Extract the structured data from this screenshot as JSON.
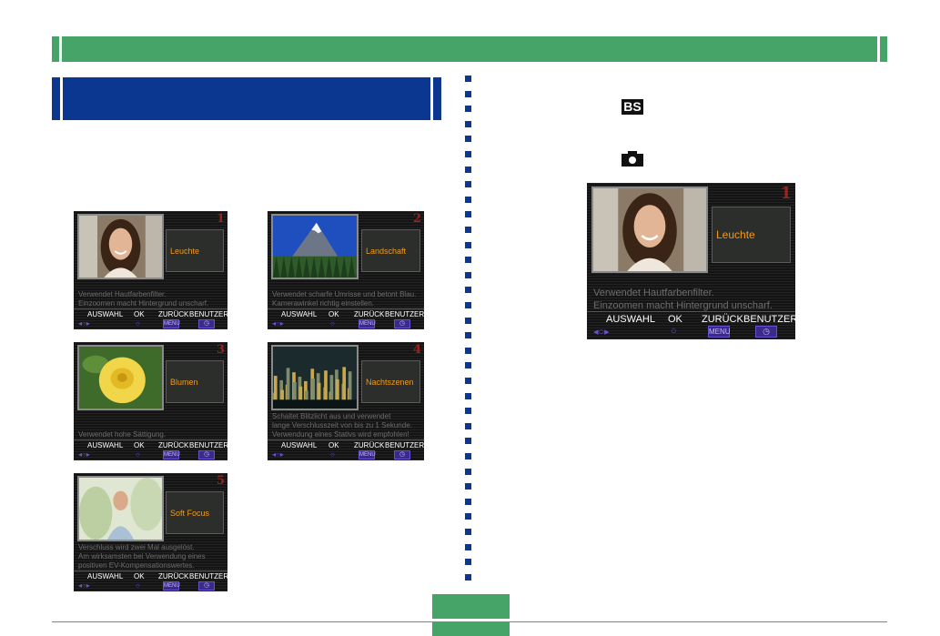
{
  "screens": [
    {
      "number": "1",
      "name": "Leuchte",
      "desc": "Verwendet Hautfarbenfilter.\nEinzoomen macht Hintergrund unscharf."
    },
    {
      "number": "2",
      "name": "Landschaft",
      "desc": "Verwendet scharfe Umrisse und betont Blau.\nKamerawinkel richtig einstellen."
    },
    {
      "number": "3",
      "name": "Blumen",
      "desc": "Verwendet hohe Sättigung."
    },
    {
      "number": "4",
      "name": "Nachtszenen",
      "desc": "Schaltet Blitzlicht aus und verwendet\nlange Verschlusszeit von bis zu 1 Sekunde.\nVerwendung eines Stativs wird empfohlen!"
    },
    {
      "number": "5",
      "name": "Soft Focus",
      "desc": "Verschluss wird zwei Mal ausgelöst.\nAm wirksamsten bei Verwendung eines\npositiven EV-Kompensationswertes."
    }
  ],
  "large_screen": {
    "number": "1",
    "name": "Leuchte",
    "desc": "Verwendet Hautfarbenfilter.\nEinzoomen macht Hintergrund unscharf."
  },
  "menu": {
    "select": "AUSWAHL",
    "ok": "OK",
    "back": "ZURÜCK",
    "user": "BENUTZER",
    "menu_key": "MENU"
  },
  "icons": {
    "bs": "BS"
  },
  "colors": {
    "green": "#47a469",
    "blue": "#0b3791",
    "orange": "#f39a18"
  }
}
